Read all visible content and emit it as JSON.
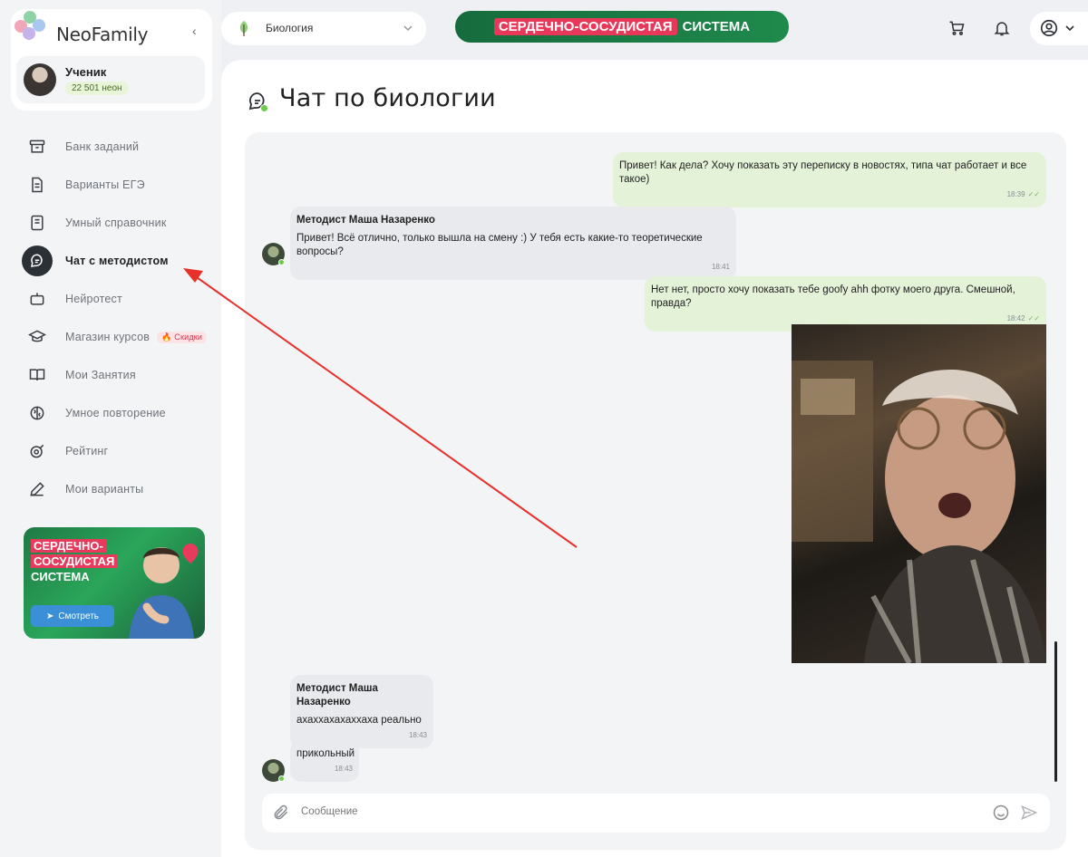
{
  "brand": {
    "name": "NeoFamily"
  },
  "user": {
    "role": "Ученик",
    "balance": "22 501 неон"
  },
  "nav": [
    {
      "label": "Банк заданий",
      "icon": "archive-icon"
    },
    {
      "label": "Варианты ЕГЭ",
      "icon": "document-icon"
    },
    {
      "label": "Умный справочник",
      "icon": "book-icon"
    },
    {
      "label": "Чат с методистом",
      "icon": "chat-icon",
      "active": true
    },
    {
      "label": "Нейротест",
      "icon": "robot-icon"
    },
    {
      "label": "Магазин курсов",
      "icon": "graduation-cap-icon",
      "badge": "🔥 Скидки"
    },
    {
      "label": "Мои Занятия",
      "icon": "open-book-icon"
    },
    {
      "label": "Умное повторение",
      "icon": "brain-icon"
    },
    {
      "label": "Рейтинг",
      "icon": "target-icon"
    },
    {
      "label": "Мои варианты",
      "icon": "pencil-icon"
    }
  ],
  "promo": {
    "line1": "СЕРДЕЧНО-",
    "line2": "СОСУДИСТАЯ",
    "line3": "СИСТЕМА",
    "button": "Смотреть"
  },
  "topbar": {
    "subject": "Биология",
    "banner_red": "СЕРДЕЧНО-СОСУДИСТАЯ",
    "banner_rest": "СИСТЕМА"
  },
  "page": {
    "title": "Чат по биологии"
  },
  "messages": [
    {
      "text": "Привет! Как дела? Хочу показать эту переписку в новостях, типа чат работает и все такое)",
      "time": "18:39"
    },
    {
      "sender": "Методист Маша Назаренко",
      "text": "Привет! Всё отлично, только вышла на смену :) У тебя есть какие-то теоретические вопросы?",
      "time": "18:41"
    },
    {
      "text": "Нет нет, просто хочу показать тебе goofy ahh фотку моего друга. Смешной, правда?",
      "time": "18:42"
    },
    {
      "sender": "Методист Маша Назаренко",
      "text": "ахаххахахаххаха реально",
      "time": "18:43"
    },
    {
      "text": "прикольный",
      "time": "18:43"
    }
  ],
  "composer": {
    "placeholder": "Сообщение"
  },
  "colors": {
    "accent_green": "#1f8a4c",
    "highlight_red": "#e8385a",
    "outgoing_bubble": "#e4f2d8",
    "incoming_bubble": "#e9eaee"
  }
}
